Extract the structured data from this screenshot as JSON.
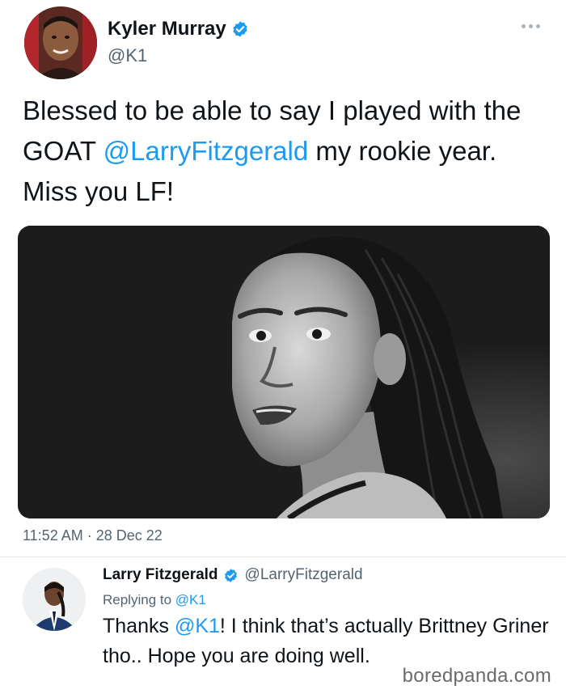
{
  "tweet": {
    "author": {
      "display_name": "Kyler Murray",
      "handle": "@K1",
      "verified": true
    },
    "text_segments": [
      {
        "text": "Blessed to be able to say I played with the GOAT ",
        "type": "plain"
      },
      {
        "text": "@LarryFitzgerald",
        "type": "mention"
      },
      {
        "text": " my rookie year. Miss you LF!",
        "type": "plain"
      }
    ],
    "timestamp": "11:52 AM · 28 Dec 22",
    "more_icon": "more-horizontal-icon"
  },
  "reply": {
    "author": {
      "display_name": "Larry Fitzgerald",
      "handle": "@LarryFitzgerald",
      "verified": true
    },
    "replying_prefix": "Replying to ",
    "replying_to": "@K1",
    "text_segments": [
      {
        "text": "Thanks ",
        "type": "plain"
      },
      {
        "text": "@K1",
        "type": "mention"
      },
      {
        "text": "! I think that’s actually Brittney Griner tho.. Hope you are doing well.",
        "type": "plain"
      }
    ]
  },
  "watermark": "boredpanda.com",
  "colors": {
    "accent": "#1d9bf0",
    "secondary_text": "#536471",
    "primary_text": "#0f1419"
  }
}
